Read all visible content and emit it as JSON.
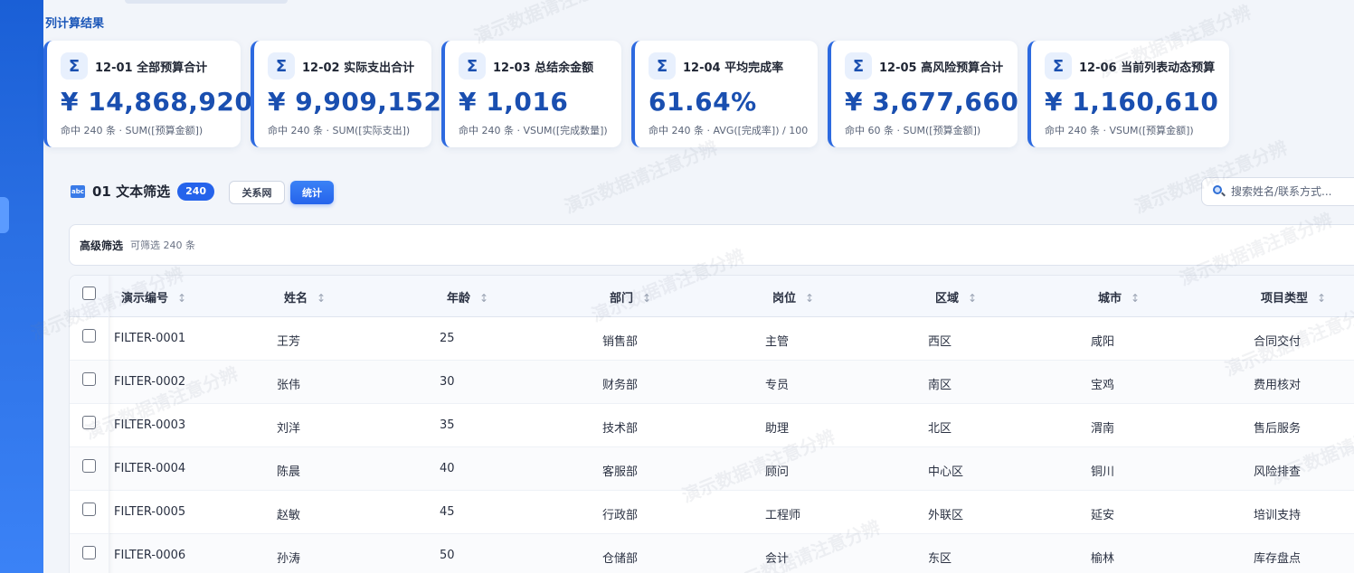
{
  "section_title": "列计算结果",
  "cards": [
    {
      "code": "12-01",
      "name": "全部预算合计",
      "value": "¥ 14,868,920",
      "sub": "命中 240 条 · SUM([预算金额])"
    },
    {
      "code": "12-02",
      "name": "实际支出合计",
      "value": "¥ 9,909,152",
      "sub": "命中 240 条 · SUM([实际支出])"
    },
    {
      "code": "12-03",
      "name": "总结余金额",
      "value": "¥ 1,016",
      "sub": "命中 240 条 · VSUM([完成数量])"
    },
    {
      "code": "12-04",
      "name": "平均完成率",
      "value": "61.64%",
      "sub": "命中 240 条 · AVG([完成率]) / 100"
    },
    {
      "code": "12-05",
      "name": "高风险预算合计",
      "value": "¥ 3,677,660",
      "sub": "命中 60 条 · SUM([预算金额])"
    },
    {
      "code": "12-06",
      "name": "当前列表动态预算",
      "value": "¥ 1,160,610",
      "sub": "命中 240 条 · VSUM([预算金额])"
    }
  ],
  "toolbar": {
    "icon_text": "abc",
    "title": "01 文本筛选",
    "count": "240",
    "relation_button": "关系网",
    "stat_button": "统计"
  },
  "search": {
    "placeholder": "搜索姓名/联系方式..."
  },
  "advanced_filter": {
    "title": "高级筛选",
    "subtitle": "可筛选 240 条"
  },
  "table": {
    "columns": [
      "演示编号",
      "姓名",
      "年龄",
      "部门",
      "岗位",
      "区域",
      "城市",
      "项目类型"
    ],
    "sort_glyph": "↕",
    "rows": [
      [
        "FILTER-0001",
        "王芳",
        "25",
        "销售部",
        "主管",
        "西区",
        "咸阳",
        "合同交付"
      ],
      [
        "FILTER-0002",
        "张伟",
        "30",
        "财务部",
        "专员",
        "南区",
        "宝鸡",
        "费用核对"
      ],
      [
        "FILTER-0003",
        "刘洋",
        "35",
        "技术部",
        "助理",
        "北区",
        "渭南",
        "售后服务"
      ],
      [
        "FILTER-0004",
        "陈晨",
        "40",
        "客服部",
        "顾问",
        "中心区",
        "铜川",
        "风险排查"
      ],
      [
        "FILTER-0005",
        "赵敏",
        "45",
        "行政部",
        "工程师",
        "外联区",
        "延安",
        "培训支持"
      ],
      [
        "FILTER-0006",
        "孙涛",
        "50",
        "仓储部",
        "会计",
        "东区",
        "榆林",
        "库存盘点"
      ]
    ]
  },
  "watermark_text": "演示数据请注意分辨"
}
